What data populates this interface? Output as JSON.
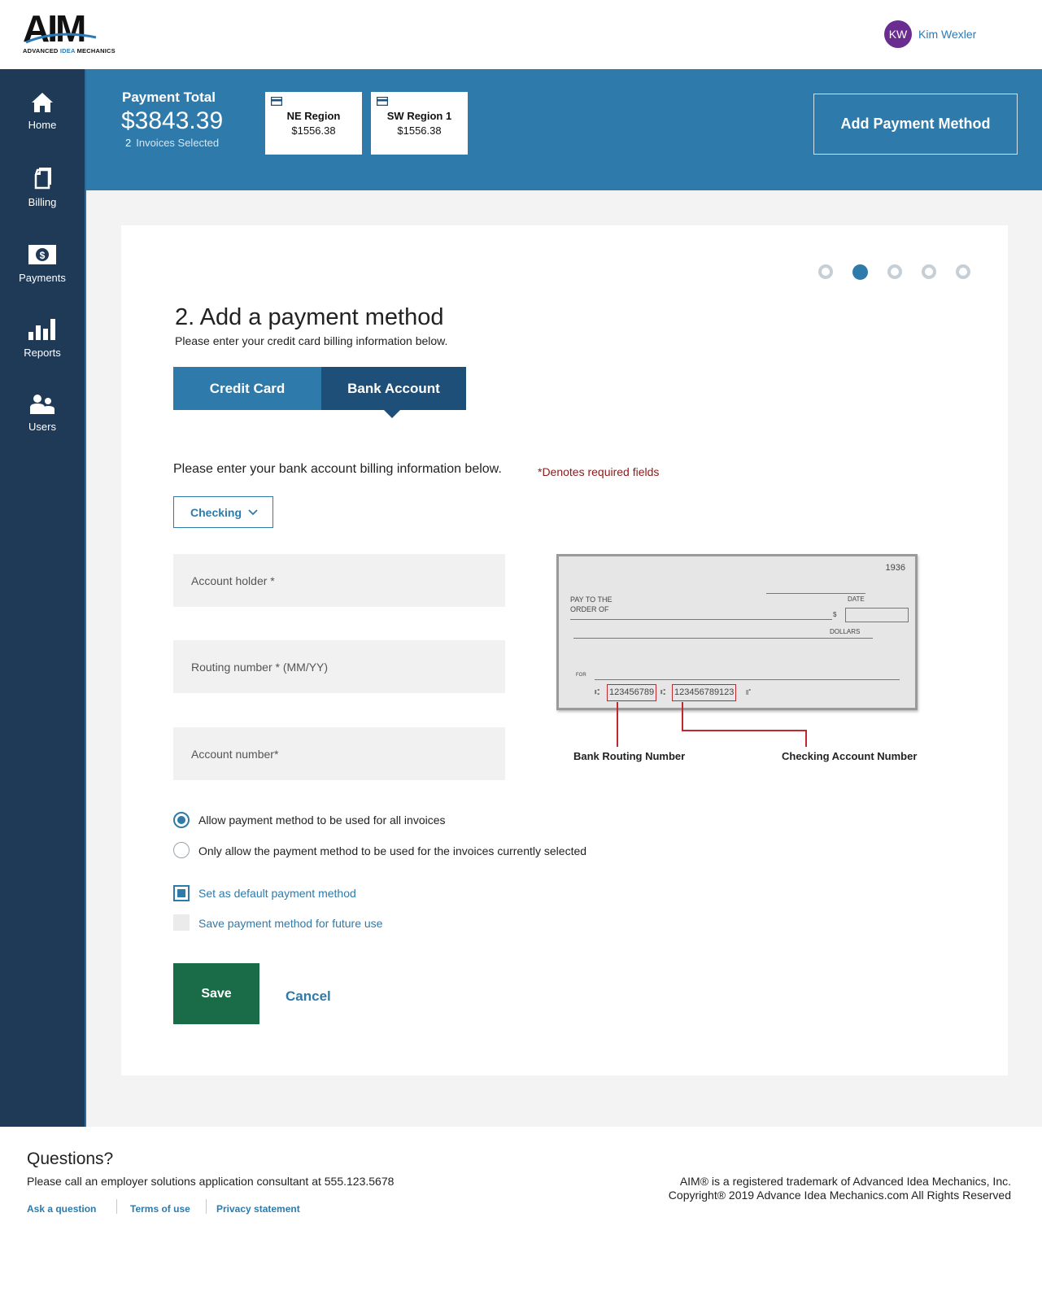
{
  "header": {
    "logo_text": "AIM",
    "logo_tagline_pre": "ADVANCED ",
    "logo_tagline_idea": "IDEA",
    "logo_tagline_post": " MECHANICS",
    "user_initials": "KW",
    "user_name": "Kim Wexler",
    "avatar_color": "#6b2c8f"
  },
  "sidebar": {
    "items": [
      {
        "label": "Home",
        "icon": "home-icon"
      },
      {
        "label": "Billing",
        "icon": "billing-icon"
      },
      {
        "label": "Payments",
        "icon": "payments-icon"
      },
      {
        "label": "Reports",
        "icon": "reports-icon"
      },
      {
        "label": "Users",
        "icon": "users-icon"
      }
    ]
  },
  "summary": {
    "label": "Payment Total",
    "amount": "$3843.39",
    "invoice_count": "2",
    "invoice_text": "Invoices Selected",
    "regions": [
      {
        "name": "NE Region",
        "amount": "$1556.38"
      },
      {
        "name": "SW Region 1",
        "amount": "$1556.38"
      }
    ],
    "add_button": "Add Payment Method"
  },
  "steps": {
    "total": 5,
    "active_index": 1
  },
  "form": {
    "title": "2. Add a payment method",
    "subtitle": "Please enter your credit card billing information below.",
    "tabs": [
      "Credit Card",
      "Bank Account"
    ],
    "active_tab": "Bank Account",
    "intro": "Please enter your bank account billing information below.",
    "required_note": "*Denotes required fields",
    "account_type": "Checking",
    "fields": {
      "holder_placeholder": "Account holder *",
      "routing_placeholder": "Routing number * (MM/YY)",
      "account_placeholder": "Account number*"
    },
    "options": {
      "all_invoices": "Allow payment method to be used for all invoices",
      "selected_only": "Only allow the payment method to be used for the invoices currently selected",
      "default_pm": "Set as default payment method",
      "save_future": "Save payment method for future use"
    },
    "save_label": "Save",
    "cancel_label": "Cancel"
  },
  "check_image": {
    "check_number": "1936",
    "date_label": "DATE",
    "pay_to_line1": "PAY TO THE",
    "pay_to_line2": "ORDER OF",
    "dollar_sign": "$",
    "dollars_label": "DOLLARS",
    "for_label": "FOR",
    "routing_sample": "123456789",
    "account_sample": "123456789123",
    "routing_caption": "Bank Routing Number",
    "account_caption": "Checking Account Number"
  },
  "footer": {
    "questions_title": "Questions?",
    "questions_text": "Please call an employer solutions application consultant at 555.123.5678",
    "links": [
      "Ask a question",
      "Terms of use",
      "Privacy statement"
    ],
    "legal_line1": "AIM® is a registered trademark of Advanced Idea Mechanics, Inc.",
    "legal_line2": "Copyright® 2019 Advance Idea Mechanics.com All Rights Reserved"
  },
  "colors": {
    "primary_blue": "#2d7aab",
    "dark_navy": "#1e3a56",
    "tab_dark": "#1e4f78",
    "save_green": "#1a6b47",
    "required_red": "#8b1a1a"
  }
}
